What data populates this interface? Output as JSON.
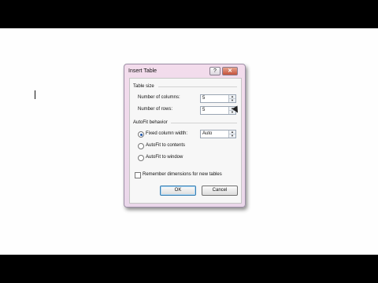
{
  "dialog": {
    "title": "Insert Table",
    "help_label": "?",
    "close_label": "✕",
    "table_size": {
      "heading": "Table size",
      "columns_label": "Number of columns:",
      "columns_value": "5",
      "rows_label": "Number of rows:",
      "rows_value": "5"
    },
    "autofit": {
      "heading": "AutoFit behavior",
      "fixed_label": "Fixed column width:",
      "fixed_value": "Auto",
      "contents_label": "AutoFit to contents",
      "window_label": "AutoFit to window",
      "selected": "fixed"
    },
    "remember_label": "Remember dimensions for new tables",
    "remember_checked": false,
    "ok_label": "OK",
    "cancel_label": "Cancel"
  },
  "icons": {
    "spin_up": "▲",
    "spin_down": "▼"
  }
}
